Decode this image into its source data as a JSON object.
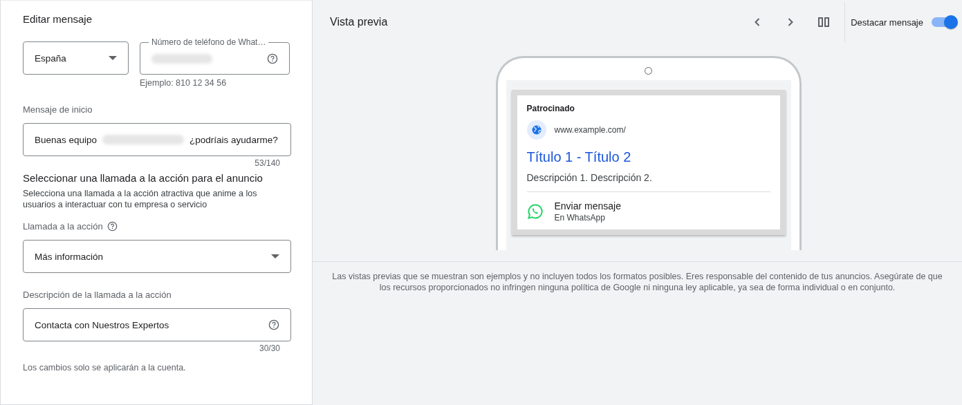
{
  "editor": {
    "title": "Editar mensaje",
    "country": {
      "value": "España"
    },
    "phone": {
      "label": "Número de teléfono de What…",
      "redacted": true,
      "hint": "Ejemplo: 810 12 34 56"
    },
    "message": {
      "label": "Mensaje de inicio",
      "before": "Buenas equipo",
      "redacted": true,
      "after": "¿podríais ayudarme?",
      "counter": "53/140"
    },
    "cta_section": {
      "title": "Seleccionar una llamada a la acción para el anuncio",
      "description": "Selecciona una llamada a la acción atractiva que anime a los usuarios a interactuar con tu empresa o servicio"
    },
    "cta": {
      "label": "Llamada a la acción",
      "value": "Más información"
    },
    "cta_description": {
      "label": "Descripción de la llamada a la acción",
      "value": "Contacta con Nuestros Expertos",
      "counter": "30/30"
    },
    "note": "Los cambios solo se aplicarán a la cuenta."
  },
  "preview": {
    "title": "Vista previa",
    "highlight": {
      "label": "Destacar mensaje",
      "on": true
    },
    "ad": {
      "sponsored": "Patrocinado",
      "url": "www.example.com/",
      "headline": "Título 1 - Título 2",
      "description": "Descripción 1. Descripción 2.",
      "action": "Enviar mensaje",
      "action_sub": "En WhatsApp"
    },
    "disclaimer": "Las vistas previas que se muestran son ejemplos y no incluyen todos los formatos posibles. Eres responsable del contenido de tus anuncios. Asegúrate de que los recursos proporcionados no infringen ninguna política de Google ni ninguna ley aplicable, ya sea de forma individual o en conjunto."
  }
}
